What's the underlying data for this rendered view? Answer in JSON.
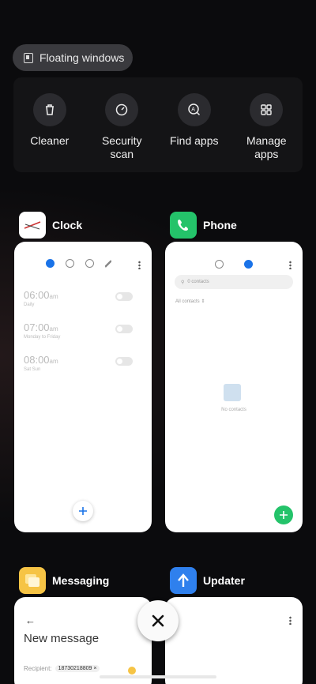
{
  "floating_windows": {
    "label": "Floating windows",
    "icon": "floating-window-icon"
  },
  "quick_actions": [
    {
      "label": "Cleaner",
      "icon": "trash-icon"
    },
    {
      "label": "Security\nscan",
      "icon": "security-scan-icon"
    },
    {
      "label": "Find apps",
      "icon": "find-apps-icon"
    },
    {
      "label": "Manage\napps",
      "icon": "grid-icon"
    }
  ],
  "apps": {
    "clock": {
      "title": "Clock",
      "alarms": [
        {
          "time": "06:00",
          "ampm": "am",
          "sub": "Daily"
        },
        {
          "time": "07:00",
          "ampm": "am",
          "sub": "Monday to Friday"
        },
        {
          "time": "08:00",
          "ampm": "am",
          "sub": "Sat Sun"
        }
      ]
    },
    "phone": {
      "title": "Phone",
      "search_placeholder": "0 contacts",
      "filter": "All contacts",
      "empty_text": "No contacts"
    },
    "messaging": {
      "title": "Messaging",
      "back": "←",
      "heading": "New message",
      "recipient_label": "Recipient:",
      "recipient_value": "18730218809"
    },
    "updater": {
      "title": "Updater"
    }
  },
  "colors": {
    "clock_accent": "#1a73e8",
    "phone_green": "#24c36a",
    "messaging_yellow": "#f6c445",
    "updater_blue": "#2f80ed"
  }
}
